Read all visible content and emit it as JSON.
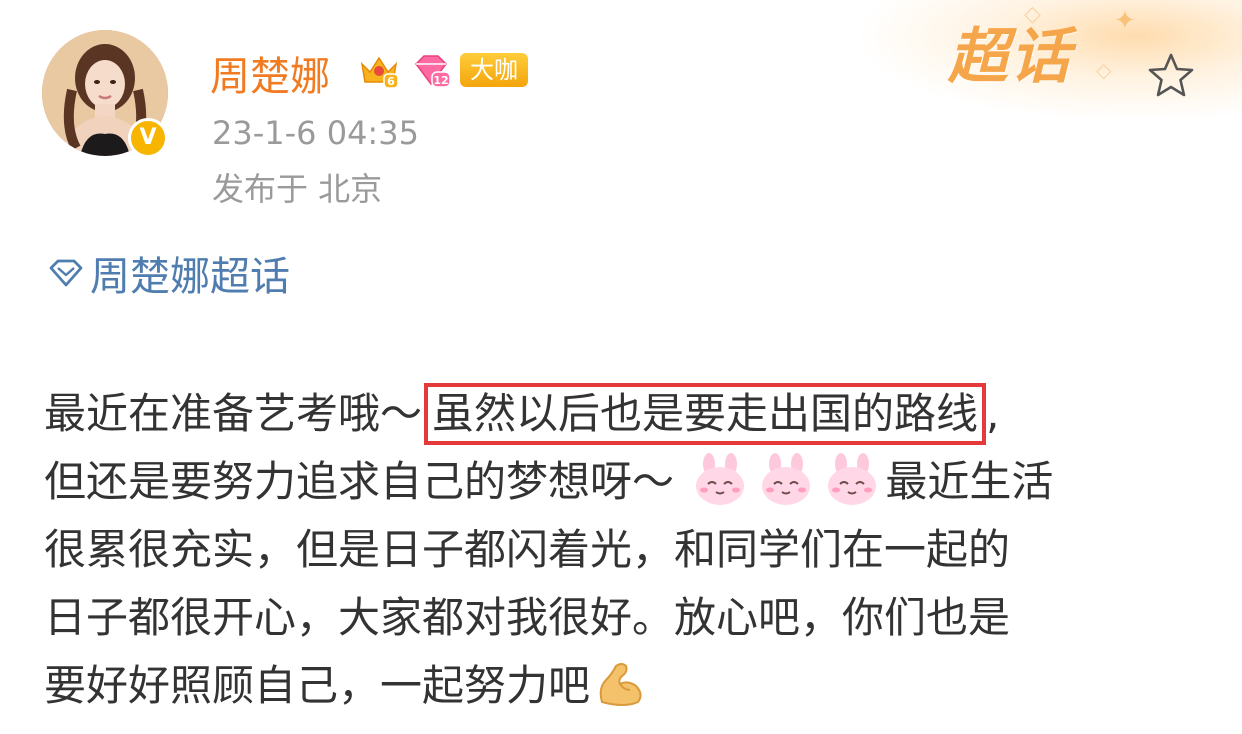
{
  "header": {
    "supertopic_mark": "超话",
    "username": "周楚娜",
    "badge_crown_level": "6",
    "badge_diamond_level": "12",
    "badge_daka": "大咖",
    "verified_mark": "V",
    "timestamp": "23-1-6 04:35",
    "location": "发布于 北京"
  },
  "topic": {
    "label": "周楚娜超话",
    "icon": "supertopic-gem-icon"
  },
  "post": {
    "line1_before": "最近在准备艺考哦～",
    "line1_highlight": "虽然以后也是要走出国的路线",
    "line1_after": ",",
    "line2_before": "但还是要努力追求自己的梦想呀～",
    "line2_after": "最近生活",
    "line3": "很累很充实，但是日子都闪着光，和同学们在一起的",
    "line4": "日子都很开心，大家都对我很好。放心吧，你们也是",
    "line5": "要好好照顾自己，一起努力吧",
    "emoji_line2": [
      "bunny-emoji",
      "bunny-emoji",
      "bunny-emoji"
    ],
    "emoji_line5": "muscle-emoji"
  },
  "colors": {
    "username": "#f07b23",
    "topic": "#507daf",
    "highlight_border": "#e53a3a",
    "meta_text": "#9a9a9a",
    "body_text": "#333333"
  }
}
